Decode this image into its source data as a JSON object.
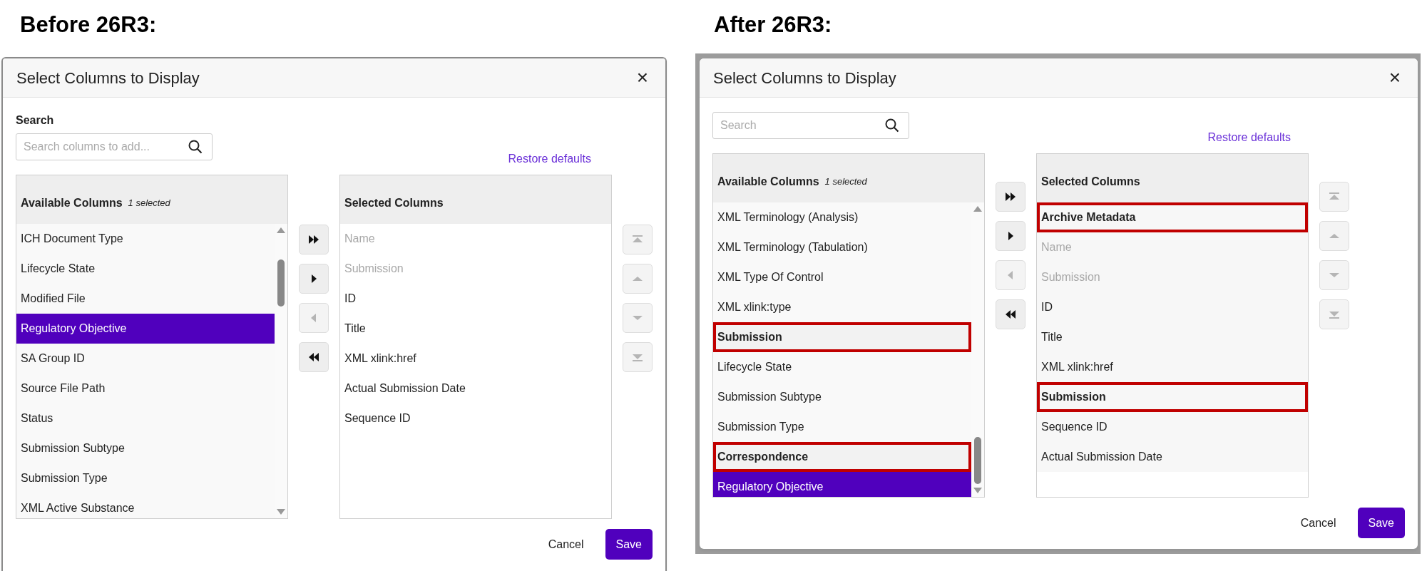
{
  "panels": [
    {
      "heading": "Before 26R3:",
      "framed": false,
      "dialog": {
        "title": "Select Columns to Display",
        "close": "×",
        "search": {
          "label": "Search",
          "placeholder": "Search columns to add..."
        },
        "restore_link": "Restore defaults",
        "available": {
          "title": "Available Columns",
          "count": "1 selected",
          "items": [
            {
              "label": "ICH Document Type",
              "kind": "item",
              "selected": false,
              "highlighted": false
            },
            {
              "label": "Lifecycle State",
              "kind": "item",
              "selected": false,
              "highlighted": false
            },
            {
              "label": "Modified File",
              "kind": "item",
              "selected": false,
              "highlighted": false
            },
            {
              "label": "Regulatory Objective",
              "kind": "item",
              "selected": true,
              "highlighted": false
            },
            {
              "label": "SA Group ID",
              "kind": "item",
              "selected": false,
              "highlighted": false
            },
            {
              "label": "Source File Path",
              "kind": "item",
              "selected": false,
              "highlighted": false
            },
            {
              "label": "Status",
              "kind": "item",
              "selected": false,
              "highlighted": false
            },
            {
              "label": "Submission Subtype",
              "kind": "item",
              "selected": false,
              "highlighted": false
            },
            {
              "label": "Submission Type",
              "kind": "item",
              "selected": false,
              "highlighted": false
            },
            {
              "label": "XML Active Substance",
              "kind": "item",
              "selected": false,
              "highlighted": false
            }
          ]
        },
        "transfer_buttons": [
          {
            "kind": "add_all",
            "disabled": false
          },
          {
            "kind": "add",
            "disabled": false
          },
          {
            "kind": "remove",
            "disabled": true
          },
          {
            "kind": "remove_all",
            "disabled": false
          }
        ],
        "selected_list": {
          "title": "Selected Columns",
          "items": [
            {
              "label": "Name",
              "kind": "item",
              "locked": true,
              "highlighted": false
            },
            {
              "label": "Submission",
              "kind": "item",
              "locked": true,
              "highlighted": false
            },
            {
              "label": "ID",
              "kind": "item",
              "locked": false,
              "highlighted": false
            },
            {
              "label": "Title",
              "kind": "item",
              "locked": false,
              "highlighted": false
            },
            {
              "label": "XML xlink:href",
              "kind": "item",
              "locked": false,
              "highlighted": false
            },
            {
              "label": "Actual Submission Date",
              "kind": "item",
              "locked": false,
              "highlighted": false
            },
            {
              "label": "Sequence ID",
              "kind": "item",
              "locked": false,
              "highlighted": false
            }
          ]
        },
        "order_buttons": [
          {
            "kind": "top",
            "disabled": true
          },
          {
            "kind": "up",
            "disabled": true
          },
          {
            "kind": "down",
            "disabled": true
          },
          {
            "kind": "bottom",
            "disabled": true
          }
        ],
        "buttons": [
          {
            "label": "Cancel",
            "kind": "secondary"
          },
          {
            "label": "Save",
            "kind": "primary"
          }
        ]
      }
    },
    {
      "heading": "After 26R3:",
      "framed": true,
      "dialog": {
        "title": "Select Columns to Display",
        "close": "×",
        "search": {
          "placeholder": "Search"
        },
        "restore_link": "Restore defaults",
        "available": {
          "title": "Available Columns",
          "count": "1 selected",
          "items": [
            {
              "label": "XML Terminology (Analysis)",
              "kind": "item",
              "selected": false,
              "highlighted": false
            },
            {
              "label": "XML Terminology (Tabulation)",
              "kind": "item",
              "selected": false,
              "highlighted": false
            },
            {
              "label": "XML Type Of Control",
              "kind": "item",
              "selected": false,
              "highlighted": false
            },
            {
              "label": "XML xlink:type",
              "kind": "item",
              "selected": false,
              "highlighted": false
            },
            {
              "label": "Submission",
              "kind": "group",
              "selected": false,
              "highlighted": true
            },
            {
              "label": "Lifecycle State",
              "kind": "item",
              "selected": false,
              "highlighted": false
            },
            {
              "label": "Submission Subtype",
              "kind": "item",
              "selected": false,
              "highlighted": false
            },
            {
              "label": "Submission Type",
              "kind": "item",
              "selected": false,
              "highlighted": false
            },
            {
              "label": "Correspondence",
              "kind": "group",
              "selected": false,
              "highlighted": true
            },
            {
              "label": "Regulatory Objective",
              "kind": "item",
              "selected": true,
              "highlighted": false
            }
          ]
        },
        "transfer_buttons": [
          {
            "kind": "add_all",
            "disabled": false
          },
          {
            "kind": "add",
            "disabled": false
          },
          {
            "kind": "remove",
            "disabled": true
          },
          {
            "kind": "remove_all",
            "disabled": false
          }
        ],
        "selected_list": {
          "title": "Selected Columns",
          "items": [
            {
              "label": "Archive Metadata",
              "kind": "group",
              "locked": false,
              "highlighted": true
            },
            {
              "label": "Name",
              "kind": "item",
              "locked": true,
              "highlighted": false
            },
            {
              "label": "Submission",
              "kind": "item",
              "locked": true,
              "highlighted": false
            },
            {
              "label": "ID",
              "kind": "item",
              "locked": false,
              "highlighted": false
            },
            {
              "label": "Title",
              "kind": "item",
              "locked": false,
              "highlighted": false
            },
            {
              "label": "XML xlink:href",
              "kind": "item",
              "locked": false,
              "highlighted": false
            },
            {
              "label": "Submission",
              "kind": "group",
              "locked": false,
              "highlighted": true
            },
            {
              "label": "Sequence ID",
              "kind": "item",
              "locked": false,
              "highlighted": false
            },
            {
              "label": "Actual Submission Date",
              "kind": "item",
              "locked": false,
              "highlighted": false
            }
          ]
        },
        "order_buttons": [
          {
            "kind": "top",
            "disabled": true
          },
          {
            "kind": "up",
            "disabled": true
          },
          {
            "kind": "down",
            "disabled": true
          },
          {
            "kind": "bottom",
            "disabled": true
          }
        ],
        "buttons": [
          {
            "label": "Cancel",
            "kind": "secondary"
          },
          {
            "label": "Save",
            "kind": "primary"
          }
        ]
      }
    }
  ]
}
